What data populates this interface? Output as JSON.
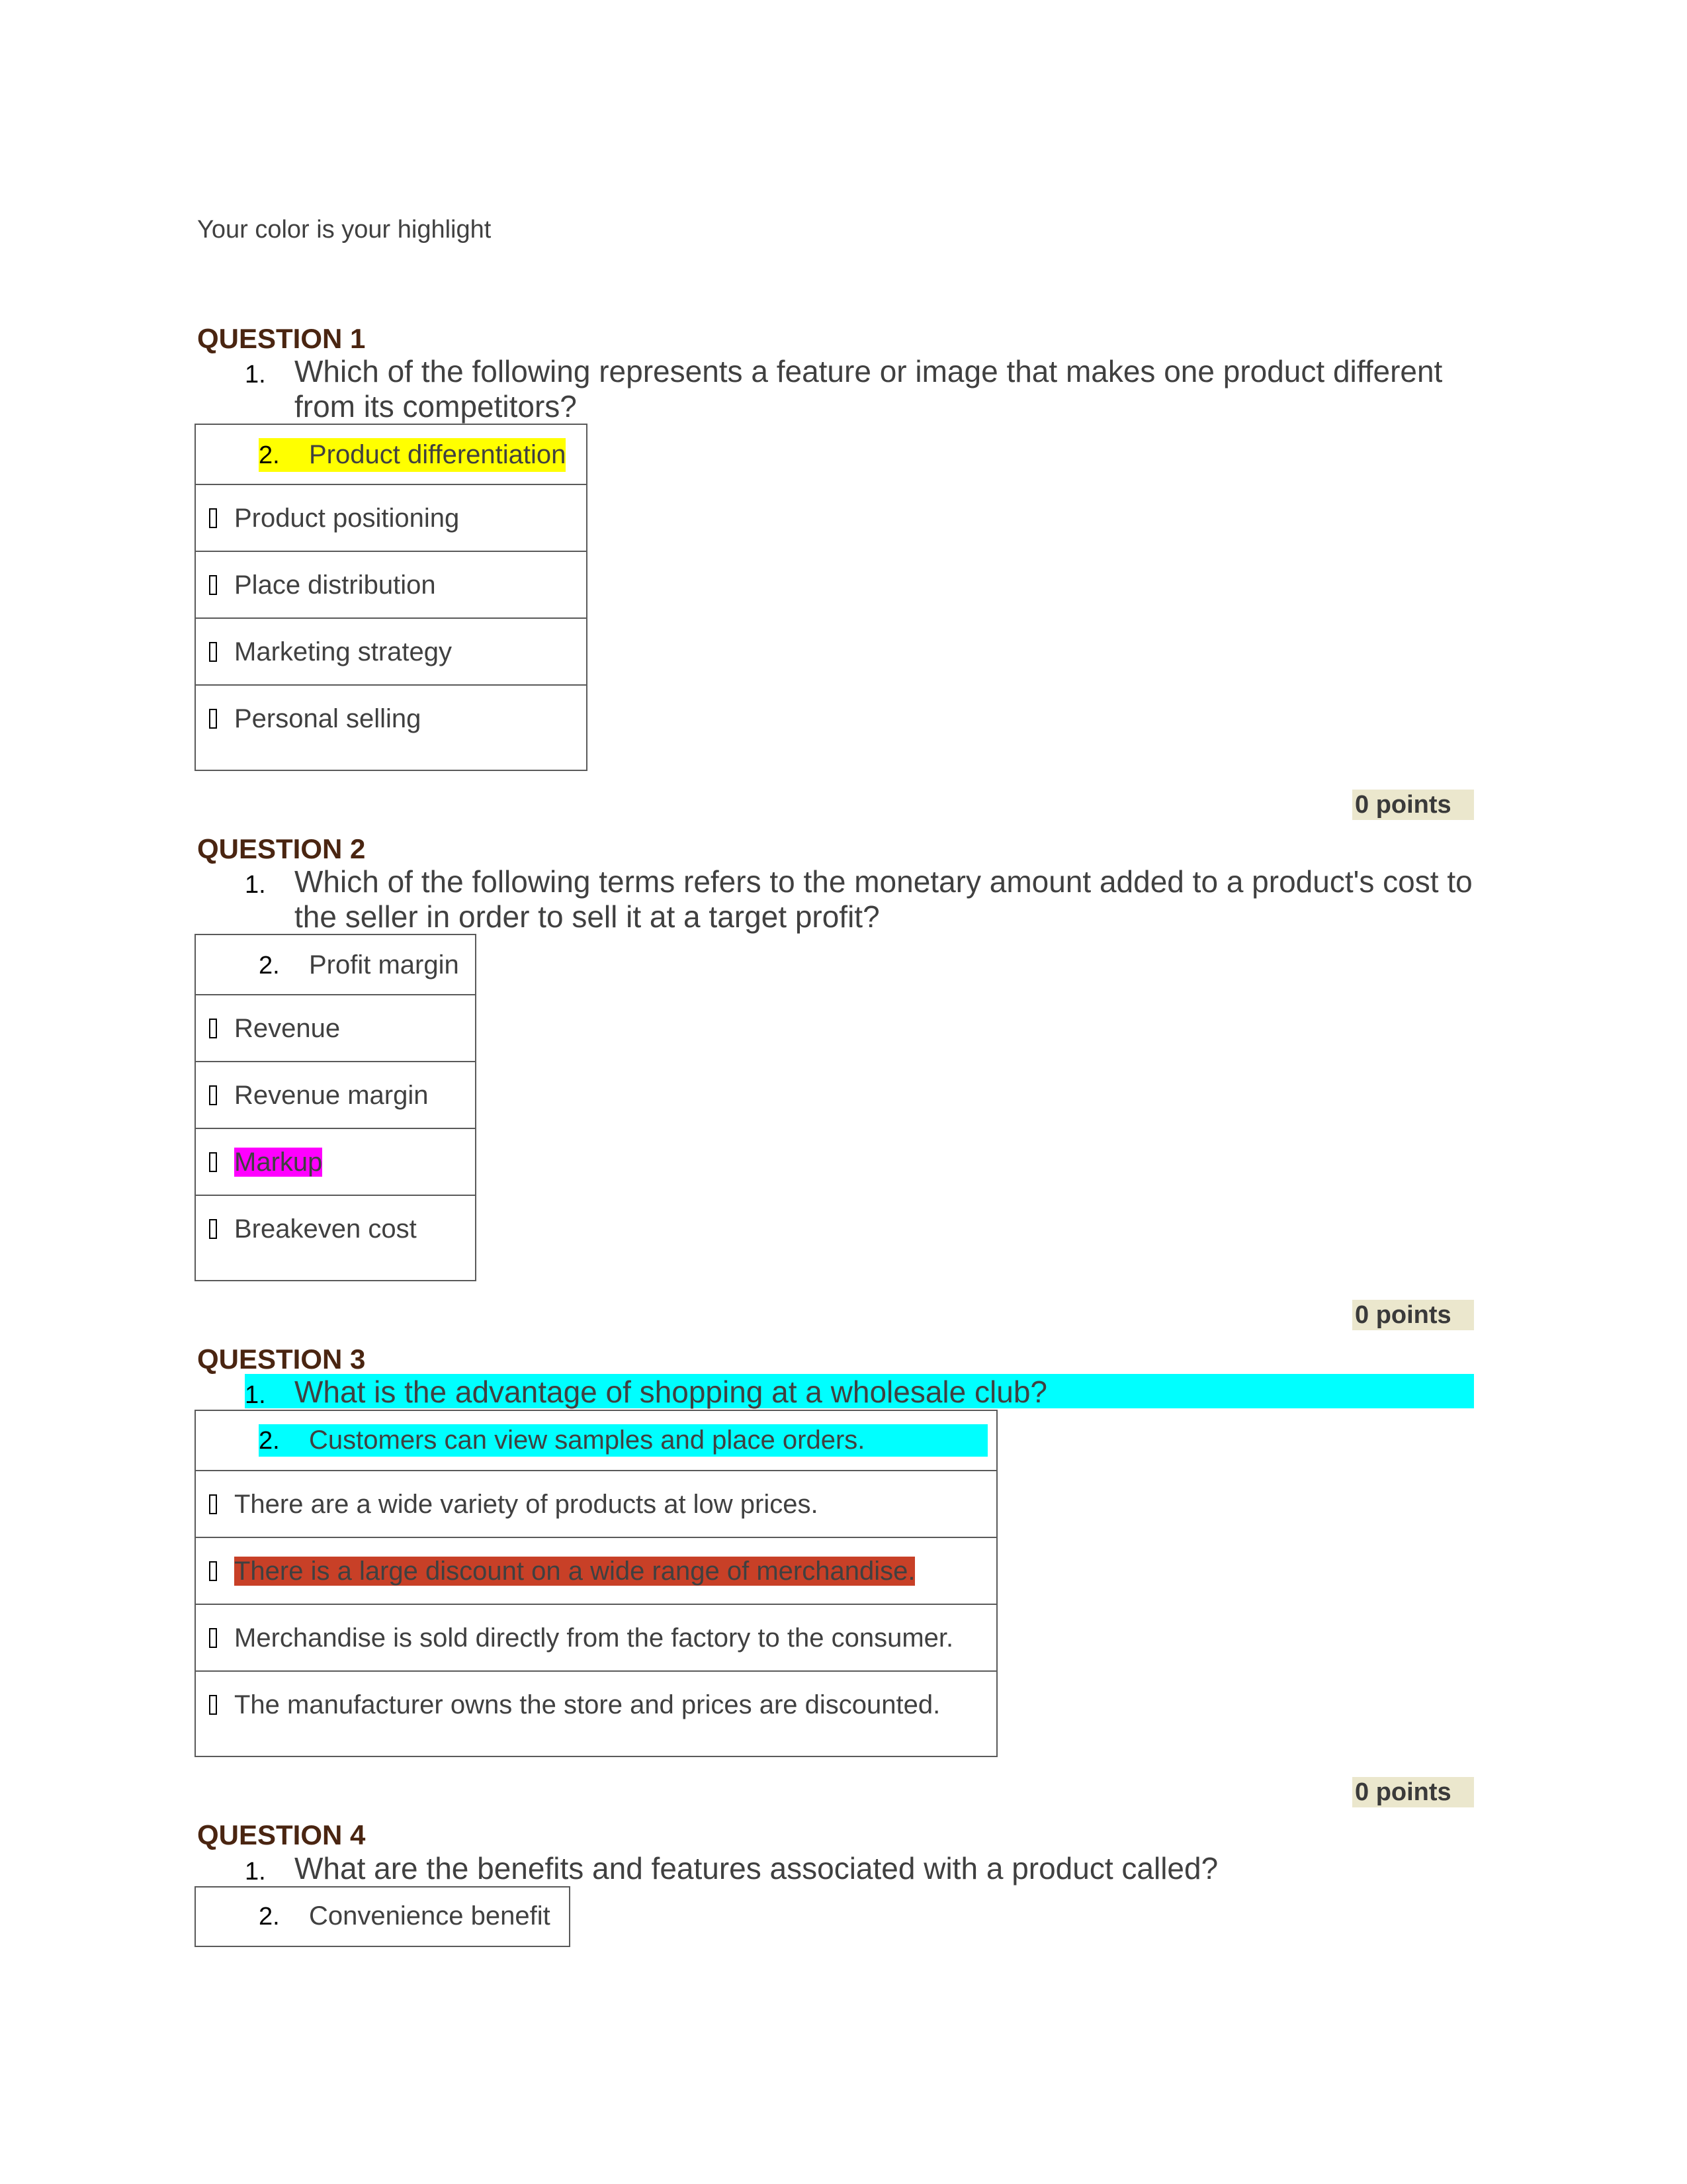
{
  "intro": "Your color is your highlight",
  "colors": {
    "heading": "#4a2511",
    "text": "#404040",
    "points_bg": "#ebe7cd",
    "highlight_yellow": "#ffff00",
    "highlight_magenta": "#ff00ff",
    "highlight_cyan": "#00ffff",
    "highlight_red": "#c84027"
  },
  "questions": [
    {
      "heading": "QUESTION 1",
      "number": "1.",
      "text_lines": [
        "Which of the following represents a feature or image that makes one product different",
        "from its competitors?"
      ],
      "first_option": {
        "number": "2.",
        "label": "Product differentiation",
        "highlight": "yellow"
      },
      "options": [
        {
          "label": "Product positioning"
        },
        {
          "label": "Place distribution"
        },
        {
          "label": "Marketing strategy"
        },
        {
          "label": "Personal selling"
        }
      ],
      "points": "0 points"
    },
    {
      "heading": "QUESTION 2",
      "number": "1.",
      "text_lines": [
        "Which of the following terms refers to the monetary amount added to a product's cost to",
        "the seller in order to sell it at a target profit?"
      ],
      "first_option": {
        "number": "2.",
        "label": "Profit margin"
      },
      "options": [
        {
          "label": "Revenue"
        },
        {
          "label": "Revenue margin"
        },
        {
          "label": "Markup",
          "highlight": "magenta"
        },
        {
          "label": "Breakeven cost"
        }
      ],
      "points": "0 points"
    },
    {
      "heading": "QUESTION 3",
      "number": "1.",
      "text_lines": [
        "What is the advantage of shopping at a wholesale club?"
      ],
      "question_highlight": "cyan",
      "first_option": {
        "number": "2.",
        "label": "Customers can view samples and place orders.",
        "highlight": "cyan"
      },
      "options": [
        {
          "label": "There are a wide variety of products at low prices."
        },
        {
          "label": "There is a large discount on a wide range of merchandise.",
          "highlight": "red"
        },
        {
          "label": "Merchandise is sold directly from the factory to the consumer."
        },
        {
          "label": "The manufacturer owns the store and prices are discounted."
        }
      ],
      "points": "0 points"
    },
    {
      "heading": "QUESTION 4",
      "number": "1.",
      "text_lines": [
        "What are the benefits and features associated with a product called?"
      ],
      "first_option": {
        "number": "2.",
        "label": "Convenience benefit"
      }
    }
  ]
}
